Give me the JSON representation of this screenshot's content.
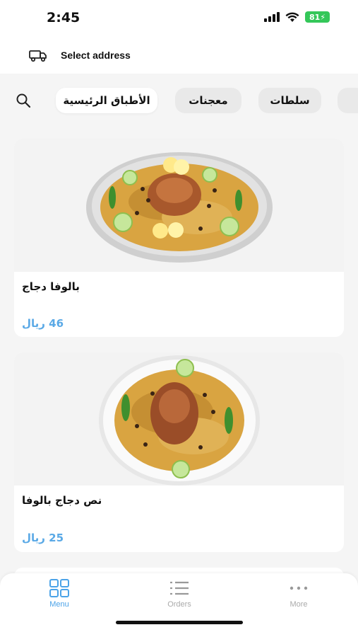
{
  "status": {
    "time": "2:45",
    "battery": "81"
  },
  "header": {
    "address_label": "Select address",
    "truck_icon": "truck-icon"
  },
  "categories": {
    "items": [
      {
        "label": "الأطباق الرئيسية",
        "active": true
      },
      {
        "label": "معجنات",
        "active": false
      },
      {
        "label": "سلطات",
        "active": false
      }
    ]
  },
  "products": [
    {
      "name": "بالوفا دجاج",
      "price": "46 ريال"
    },
    {
      "name": "نص دجاج بالوفا",
      "price": "25 ريال"
    }
  ],
  "tabbar": {
    "items": [
      {
        "label": "Menu",
        "icon": "grid-icon",
        "active": true
      },
      {
        "label": "Orders",
        "icon": "list-icon",
        "active": false
      },
      {
        "label": "More",
        "icon": "more-icon",
        "active": false
      }
    ]
  },
  "colors": {
    "accent": "#4ba3e8",
    "price": "#5aa9e6",
    "battery": "#34c759"
  }
}
